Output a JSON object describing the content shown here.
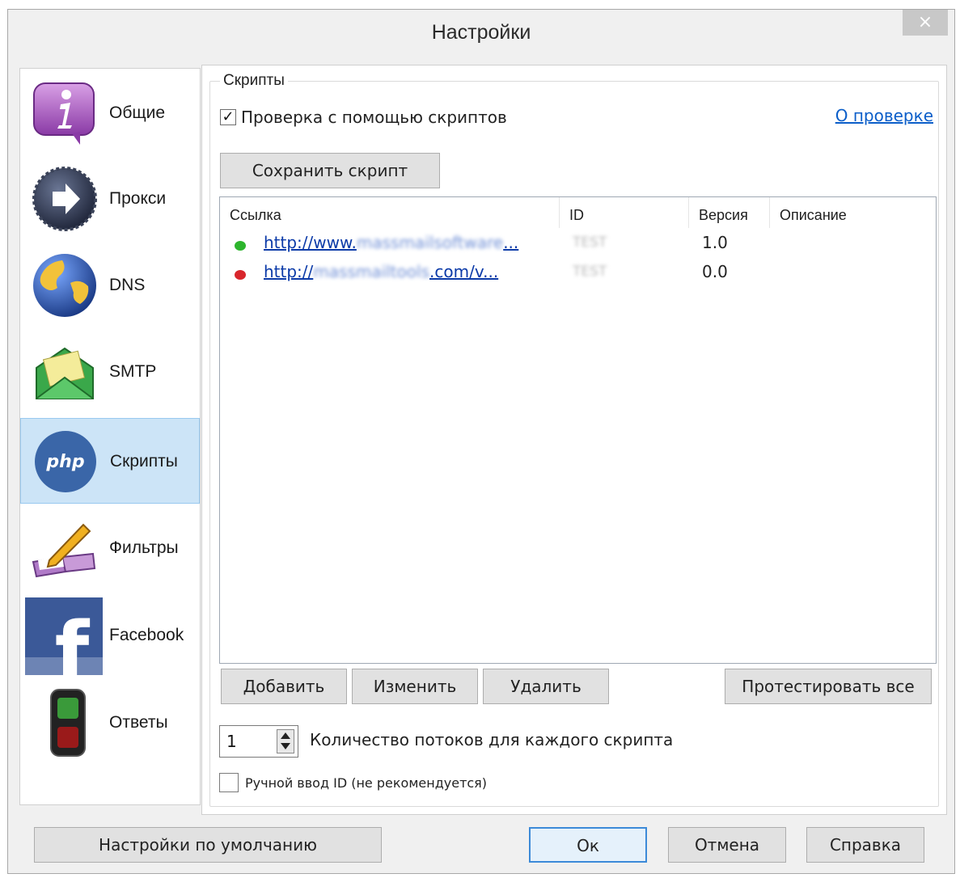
{
  "window": {
    "title": "Настройки",
    "close_glyph": "×"
  },
  "sidebar": {
    "items": [
      {
        "label": "Общие",
        "icon": "info-icon",
        "selected": false
      },
      {
        "label": "Прокси",
        "icon": "arrow-circle-icon",
        "selected": false
      },
      {
        "label": "DNS",
        "icon": "globe-icon",
        "selected": false
      },
      {
        "label": "SMTP",
        "icon": "envelope-icon",
        "selected": false
      },
      {
        "label": "Скрипты",
        "icon": "php-icon",
        "selected": true
      },
      {
        "label": "Фильтры",
        "icon": "book-pencil-icon",
        "selected": false
      },
      {
        "label": "Facebook",
        "icon": "facebook-icon",
        "selected": false
      },
      {
        "label": "Ответы",
        "icon": "traffic-light-icon",
        "selected": false
      }
    ],
    "php_text": "php",
    "facebook_letter": "f"
  },
  "scripts": {
    "group_label": "Скрипты",
    "enable_checkbox_label": "Проверка с помощью скриптов",
    "enable_checked": true,
    "about_link": "О проверке",
    "save_button": "Сохранить скрипт",
    "table": {
      "columns": [
        "Ссылка",
        "ID",
        "Версия",
        "Описание"
      ],
      "rows": [
        {
          "status": "green",
          "link_prefix": "http://www.",
          "link_blurred": "massmailsoftware",
          "link_suffix": "...",
          "id": "TEST",
          "version": "1.0",
          "description": ""
        },
        {
          "status": "red",
          "link_prefix": "http://",
          "link_blurred": "massmailtools",
          "link_suffix": ".com/v...",
          "id": "TEST",
          "version": "0.0",
          "description": ""
        }
      ]
    },
    "buttons": {
      "add": "Добавить",
      "edit": "Изменить",
      "delete": "Удалить",
      "test_all": "Протестировать все"
    },
    "threads_value": "1",
    "threads_label": "Количество потоков для каждого скрипта",
    "manual_id_label": "Ручной ввод ID (не рекомендуется)",
    "manual_id_checked": false
  },
  "footer": {
    "defaults": "Настройки по умолчанию",
    "ok": "Ок",
    "cancel": "Отмена",
    "help": "Справка"
  },
  "colors": {
    "selection": "#cce4f7",
    "link": "#0b5ec9",
    "status_ok": "#2db52d",
    "status_fail": "#d8262c"
  }
}
